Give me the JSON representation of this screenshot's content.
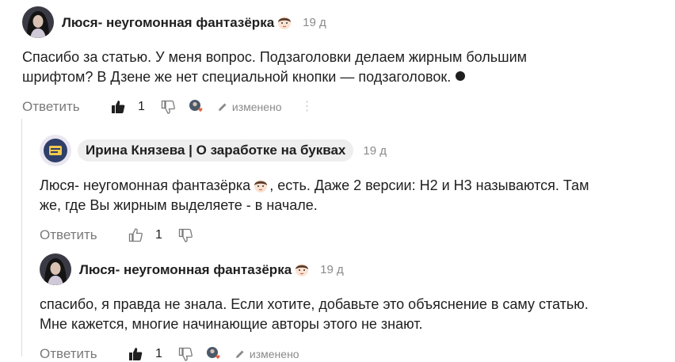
{
  "comments": [
    {
      "author": "Люся- неугомонная фантазёрка",
      "date": "19 д",
      "text_lines": [
        "Спасибо за статью. У меня вопрос. Подзаголовки делаем жирным большим",
        "шрифтом? В Дзене же нет специальной кнопки — подзаголовок."
      ],
      "reply_label": "Ответить",
      "likes": "1",
      "edited_label": "изменено"
    },
    {
      "author": "Ирина Князева | О заработке на буквах",
      "date": "19 д",
      "mention": "Люся- неугомонная фантазёрка",
      "text_line1_rest": ", есть. Даже 2 версии: Н2 и Н3 называются. Там",
      "text_line2": "же, где Вы жирным выделяете - в начале.",
      "reply_label": "Ответить",
      "likes": "1"
    },
    {
      "author": "Люся- неугомонная фантазёрка",
      "date": "19 д",
      "text_lines": [
        "спасибо, я правда не знала. Если хотите, добавьте это объяснение в саму статью.",
        "Мне кажется, многие начинающие авторы этого не знают."
      ],
      "reply_label": "Ответить",
      "likes": "1",
      "edited_label": "изменено"
    }
  ],
  "colors": {
    "text": "#1f1f1f",
    "muted": "#8a8a8a",
    "pill": "#eeeeee",
    "heart": "#e8603c"
  }
}
